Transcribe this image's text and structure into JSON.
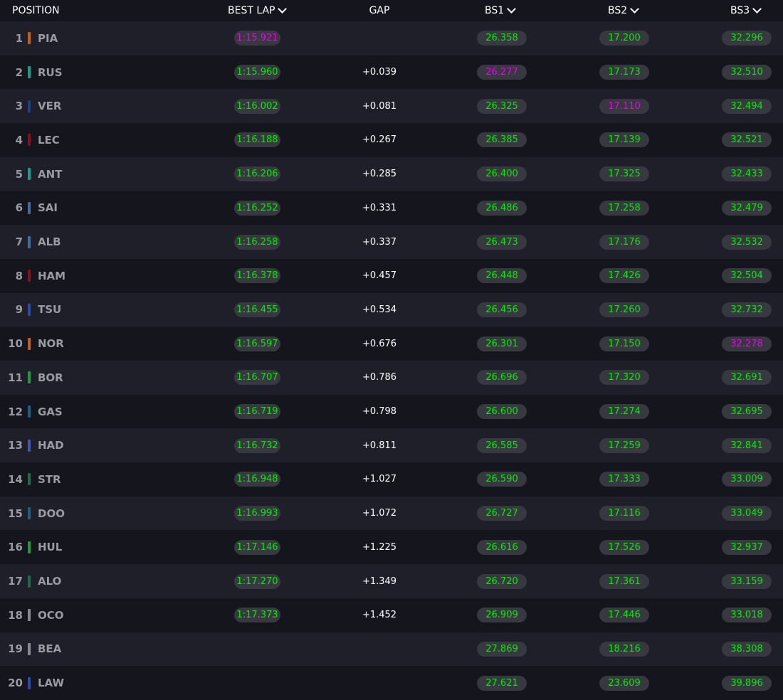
{
  "header": {
    "position": "POSITION",
    "best_lap": "BEST LAP",
    "gap": "GAP",
    "bs1": "BS1",
    "bs2": "BS2",
    "bs3": "BS3"
  },
  "colors": {
    "sector_time": "#00ee00",
    "overall_best": "#ee00ee",
    "pill_bg": "#383840",
    "row_odd": "#1f1f29",
    "row_even": "#15151e"
  },
  "rows": [
    {
      "pos": "1",
      "code": "PIA",
      "team_color": "#c8600a",
      "best_lap": "1:15.921",
      "best_lap_best": true,
      "gap": "",
      "bs1": "26.358",
      "bs1_best": false,
      "bs2": "17.200",
      "bs2_best": false,
      "bs3": "32.296",
      "bs3_best": false
    },
    {
      "pos": "2",
      "code": "RUS",
      "team_color": "#12a08a",
      "best_lap": "1:15.960",
      "best_lap_best": false,
      "gap": "+0.039",
      "bs1": "26.277",
      "bs1_best": true,
      "bs2": "17.173",
      "bs2_best": false,
      "bs3": "32.510",
      "bs3_best": false
    },
    {
      "pos": "3",
      "code": "VER",
      "team_color": "#1e3f8f",
      "best_lap": "1:16.002",
      "best_lap_best": false,
      "gap": "+0.081",
      "bs1": "26.325",
      "bs1_best": false,
      "bs2": "17.110",
      "bs2_best": true,
      "bs3": "32.494",
      "bs3_best": false
    },
    {
      "pos": "4",
      "code": "LEC",
      "team_color": "#8a0f1a",
      "best_lap": "1:16.188",
      "best_lap_best": false,
      "gap": "+0.267",
      "bs1": "26.385",
      "bs1_best": false,
      "bs2": "17.139",
      "bs2_best": false,
      "bs3": "32.521",
      "bs3_best": false
    },
    {
      "pos": "5",
      "code": "ANT",
      "team_color": "#12a08a",
      "best_lap": "1:16.206",
      "best_lap_best": false,
      "gap": "+0.285",
      "bs1": "26.400",
      "bs1_best": false,
      "bs2": "17.325",
      "bs2_best": false,
      "bs3": "32.433",
      "bs3_best": false
    },
    {
      "pos": "6",
      "code": "SAI",
      "team_color": "#3b6ea5",
      "best_lap": "1:16.252",
      "best_lap_best": false,
      "gap": "+0.331",
      "bs1": "26.486",
      "bs1_best": false,
      "bs2": "17.258",
      "bs2_best": false,
      "bs3": "32.479",
      "bs3_best": false
    },
    {
      "pos": "7",
      "code": "ALB",
      "team_color": "#3b6ea5",
      "best_lap": "1:16.258",
      "best_lap_best": false,
      "gap": "+0.337",
      "bs1": "26.473",
      "bs1_best": false,
      "bs2": "17.176",
      "bs2_best": false,
      "bs3": "32.532",
      "bs3_best": false
    },
    {
      "pos": "8",
      "code": "HAM",
      "team_color": "#8a0f1a",
      "best_lap": "1:16.378",
      "best_lap_best": false,
      "gap": "+0.457",
      "bs1": "26.448",
      "bs1_best": false,
      "bs2": "17.426",
      "bs2_best": false,
      "bs3": "32.504",
      "bs3_best": false
    },
    {
      "pos": "9",
      "code": "TSU",
      "team_color": "#2a4bb0",
      "best_lap": "1:16.455",
      "best_lap_best": false,
      "gap": "+0.534",
      "bs1": "26.456",
      "bs1_best": false,
      "bs2": "17.260",
      "bs2_best": false,
      "bs3": "32.732",
      "bs3_best": false
    },
    {
      "pos": "10",
      "code": "NOR",
      "team_color": "#c8600a",
      "best_lap": "1:16.597",
      "best_lap_best": false,
      "gap": "+0.676",
      "bs1": "26.301",
      "bs1_best": false,
      "bs2": "17.150",
      "bs2_best": false,
      "bs3": "32.278",
      "bs3_best": true
    },
    {
      "pos": "11",
      "code": "BOR",
      "team_color": "#1f9a3a",
      "best_lap": "1:16.707",
      "best_lap_best": false,
      "gap": "+0.786",
      "bs1": "26.696",
      "bs1_best": false,
      "bs2": "17.320",
      "bs2_best": false,
      "bs3": "32.691",
      "bs3_best": false
    },
    {
      "pos": "12",
      "code": "GAS",
      "team_color": "#1a5f8a",
      "best_lap": "1:16.719",
      "best_lap_best": false,
      "gap": "+0.798",
      "bs1": "26.600",
      "bs1_best": false,
      "bs2": "17.274",
      "bs2_best": false,
      "bs3": "32.695",
      "bs3_best": false
    },
    {
      "pos": "13",
      "code": "HAD",
      "team_color": "#3f57b5",
      "best_lap": "1:16.732",
      "best_lap_best": false,
      "gap": "+0.811",
      "bs1": "26.585",
      "bs1_best": false,
      "bs2": "17.259",
      "bs2_best": false,
      "bs3": "32.841",
      "bs3_best": false
    },
    {
      "pos": "14",
      "code": "STR",
      "team_color": "#1a6b50",
      "best_lap": "1:16.948",
      "best_lap_best": false,
      "gap": "+1.027",
      "bs1": "26.590",
      "bs1_best": false,
      "bs2": "17.333",
      "bs2_best": false,
      "bs3": "33.009",
      "bs3_best": false
    },
    {
      "pos": "15",
      "code": "DOO",
      "team_color": "#1a5f8a",
      "best_lap": "1:16.993",
      "best_lap_best": false,
      "gap": "+1.072",
      "bs1": "26.727",
      "bs1_best": false,
      "bs2": "17.116",
      "bs2_best": false,
      "bs3": "33.049",
      "bs3_best": false
    },
    {
      "pos": "16",
      "code": "HUL",
      "team_color": "#1f9a3a",
      "best_lap": "1:17.146",
      "best_lap_best": false,
      "gap": "+1.225",
      "bs1": "26.616",
      "bs1_best": false,
      "bs2": "17.526",
      "bs2_best": false,
      "bs3": "32.937",
      "bs3_best": false
    },
    {
      "pos": "17",
      "code": "ALO",
      "team_color": "#1a6b50",
      "best_lap": "1:17.270",
      "best_lap_best": false,
      "gap": "+1.349",
      "bs1": "26.720",
      "bs1_best": false,
      "bs2": "17.361",
      "bs2_best": false,
      "bs3": "33.159",
      "bs3_best": false
    },
    {
      "pos": "18",
      "code": "OCO",
      "team_color": "#8a8a90",
      "best_lap": "1:17.373",
      "best_lap_best": false,
      "gap": "+1.452",
      "bs1": "26.909",
      "bs1_best": false,
      "bs2": "17.446",
      "bs2_best": false,
      "bs3": "33.018",
      "bs3_best": false
    },
    {
      "pos": "19",
      "code": "BEA",
      "team_color": "#8a8a90",
      "best_lap": "",
      "best_lap_best": false,
      "gap": "",
      "bs1": "27.869",
      "bs1_best": false,
      "bs2": "18.216",
      "bs2_best": false,
      "bs3": "38.308",
      "bs3_best": false
    },
    {
      "pos": "20",
      "code": "LAW",
      "team_color": "#2a4bb0",
      "best_lap": "",
      "best_lap_best": false,
      "gap": "",
      "bs1": "27.621",
      "bs1_best": false,
      "bs2": "23.609",
      "bs2_best": false,
      "bs3": "39.896",
      "bs3_best": false
    }
  ]
}
